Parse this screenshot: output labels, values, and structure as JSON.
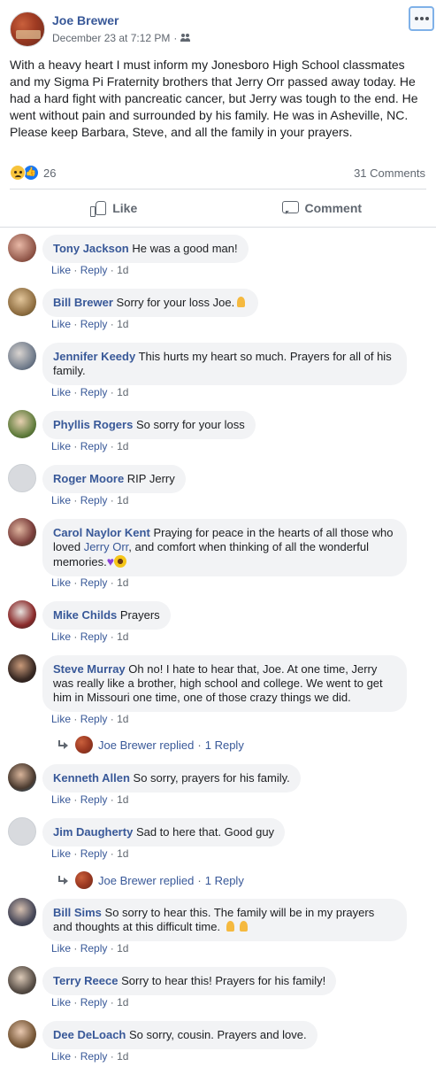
{
  "post": {
    "author": "Joe Brewer",
    "date": "December 23 at 7:12 PM",
    "meta_separator": "·",
    "text": "With a heavy heart I must inform my Jonesboro High School classmates and my Sigma Pi Fraternity brothers that Jerry Orr passed away today. He had a hard fight with pancreatic cancer, but Jerry was tough to the end. He went without pain and surrounded by his family. He was in Asheville, NC. Please keep Barbara, Steve, and all the family in your prayers.",
    "reaction_count": "26",
    "comment_count": "31 Comments",
    "like_label": "Like",
    "comment_label": "Comment"
  },
  "actions": {
    "like": "Like",
    "reply": "Reply",
    "dot": "·",
    "time": "1d"
  },
  "comments": [
    {
      "name": "Tony Jackson",
      "text": "He was a good man!"
    },
    {
      "name": "Bill Brewer",
      "text": "Sorry for your loss Joe."
    },
    {
      "name": "Jennifer Keedy",
      "text": "This hurts my heart so much. Prayers for all of his family."
    },
    {
      "name": "Phyllis Rogers",
      "text": "So sorry for your loss"
    },
    {
      "name": "Roger Moore",
      "text": "RIP Jerry"
    },
    {
      "name": "Carol Naylor Kent",
      "text_a": "Praying for peace in the hearts of all those who loved",
      "link": "Jerry Orr",
      "text_b": ", and comfort when thinking of all the wonderful memories."
    },
    {
      "name": "Mike Childs",
      "text": "Prayers"
    },
    {
      "name": "Steve Murray",
      "text": "Oh no! I hate to hear that, Joe. At one time, Jerry was really like a brother, high school and college. We went to get him in Missouri one time, one of those crazy things we did.",
      "reply": "Joe Brewer replied",
      "reply_count": "1 Reply"
    },
    {
      "name": "Kenneth Allen",
      "text": "So sorry, prayers for his family."
    },
    {
      "name": "Jim Daugherty",
      "text": "Sad to here that. Good guy",
      "reply": "Joe Brewer replied",
      "reply_count": "1 Reply"
    },
    {
      "name": "Bill Sims",
      "text": "So sorry to hear this. The family will be in my prayers and thoughts at this difficult time."
    },
    {
      "name": "Terry Reece",
      "text": "Sorry to hear this! Prayers for his family!"
    },
    {
      "name": "Dee DeLoach",
      "text": "So sorry, cousin. Prayers and love."
    }
  ],
  "colors": {
    "link_blue": "#385898",
    "bubble_bg": "#f2f3f5",
    "meta_gray": "#606770"
  }
}
